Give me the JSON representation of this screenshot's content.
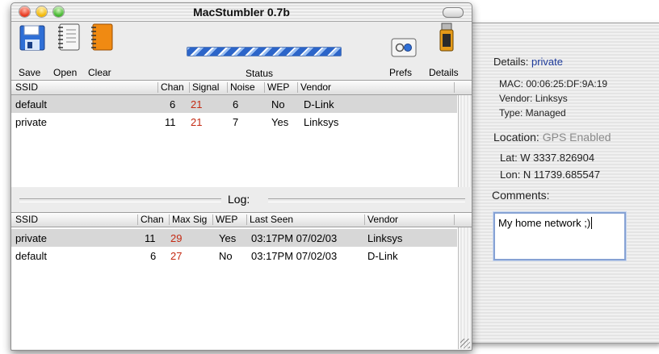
{
  "window": {
    "title": "MacStumbler 0.7b"
  },
  "toolbar": {
    "save_label": "Save",
    "open_label": "Open",
    "clear_label": "Clear",
    "status_label": "Status",
    "prefs_label": "Prefs",
    "details_label": "Details"
  },
  "networks": {
    "headers": [
      "SSID",
      "Chan",
      "Signal",
      "Noise",
      "WEP",
      "Vendor"
    ],
    "rows": [
      {
        "ssid": "default",
        "chan": "6",
        "signal": "21",
        "noise": "6",
        "wep": "No",
        "vendor": "D-Link"
      },
      {
        "ssid": "private",
        "chan": "11",
        "signal": "21",
        "noise": "7",
        "wep": "Yes",
        "vendor": "Linksys"
      }
    ]
  },
  "log": {
    "title": "Log:",
    "headers": [
      "SSID",
      "Chan",
      "Max Sig",
      "WEP",
      "Last Seen",
      "Vendor"
    ],
    "rows": [
      {
        "ssid": "private",
        "chan": "11",
        "max_sig": "29",
        "wep": "Yes",
        "last_seen": "03:17PM 07/02/03",
        "vendor": "Linksys"
      },
      {
        "ssid": "default",
        "chan": "6",
        "max_sig": "27",
        "wep": "No",
        "last_seen": "03:17PM 07/02/03",
        "vendor": "D-Link"
      }
    ]
  },
  "details": {
    "label": "Details:",
    "name": "private",
    "mac": "MAC: 00:06:25:DF:9A:19",
    "vendor": "Vendor: Linksys",
    "type": "Type: Managed",
    "location_label": "Location:",
    "location_value": "GPS Enabled",
    "lat": "Lat:  W 3337.826904",
    "lon": "Lon:  N 11739.685547",
    "comments_label": "Comments:",
    "comments_value": "My home network ;)"
  },
  "colors": {
    "signal_red": "#c42a13",
    "details_blue": "#1d3a9a",
    "selection": "#d7d7d7"
  }
}
